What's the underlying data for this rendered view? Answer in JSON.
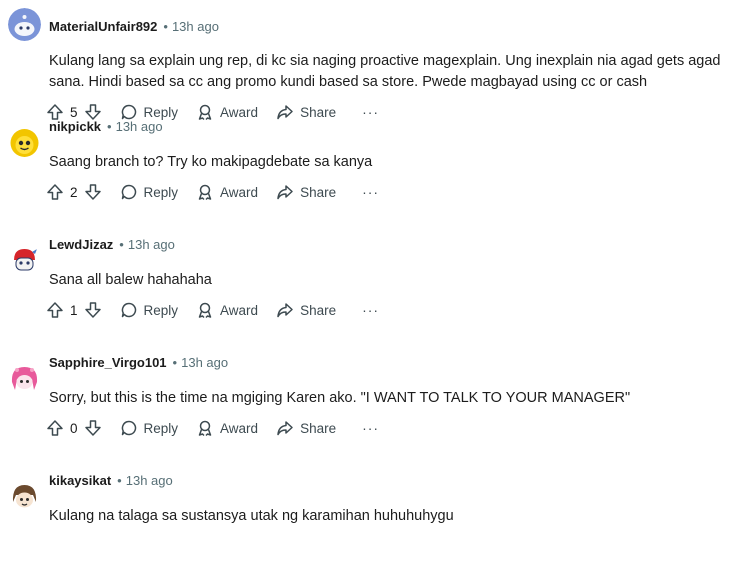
{
  "comments": [
    {
      "username": "MaterialUnfair892",
      "time": "13h ago",
      "text": "Kulang lang sa explain ung rep, di kc sia naging proactive magexplain. Ung inexplain nia agad gets agad sana. Hindi based sa cc ang promo kundi based sa store. Pwede magbayad using cc or cash",
      "votes": "5",
      "avatar": "blue-snoo-avatar"
    },
    {
      "username": "nikpickk",
      "time": "13h ago",
      "text": "Saang branch to? Try ko makipagdebate sa kanya",
      "votes": "2",
      "avatar": "yellow-snoo-avatar"
    },
    {
      "username": "LewdJizaz",
      "time": "13h ago",
      "text": "Sana all balew hahahaha",
      "votes": "1",
      "avatar": "red-helmet-snoo-avatar"
    },
    {
      "username": "Sapphire_Virgo101",
      "time": "13h ago",
      "text": "Sorry, but this is the time na mgiging Karen ako. \"I WANT TO TALK TO YOUR MANAGER\"",
      "votes": "0",
      "avatar": "pink-hair-snoo-avatar"
    },
    {
      "username": "kikaysikat",
      "time": "13h ago",
      "text": "Kulang na talaga sa sustansya utak ng karamihan huhuhuhygu",
      "avatar": "brown-hair-snoo-avatar"
    }
  ],
  "actions": {
    "reply": "Reply",
    "award": "Award",
    "share": "Share",
    "more": "···",
    "dot": "•"
  },
  "colors": {
    "text": "#1c1c1c",
    "meta": "#576f76",
    "action": "#3d4a50"
  }
}
